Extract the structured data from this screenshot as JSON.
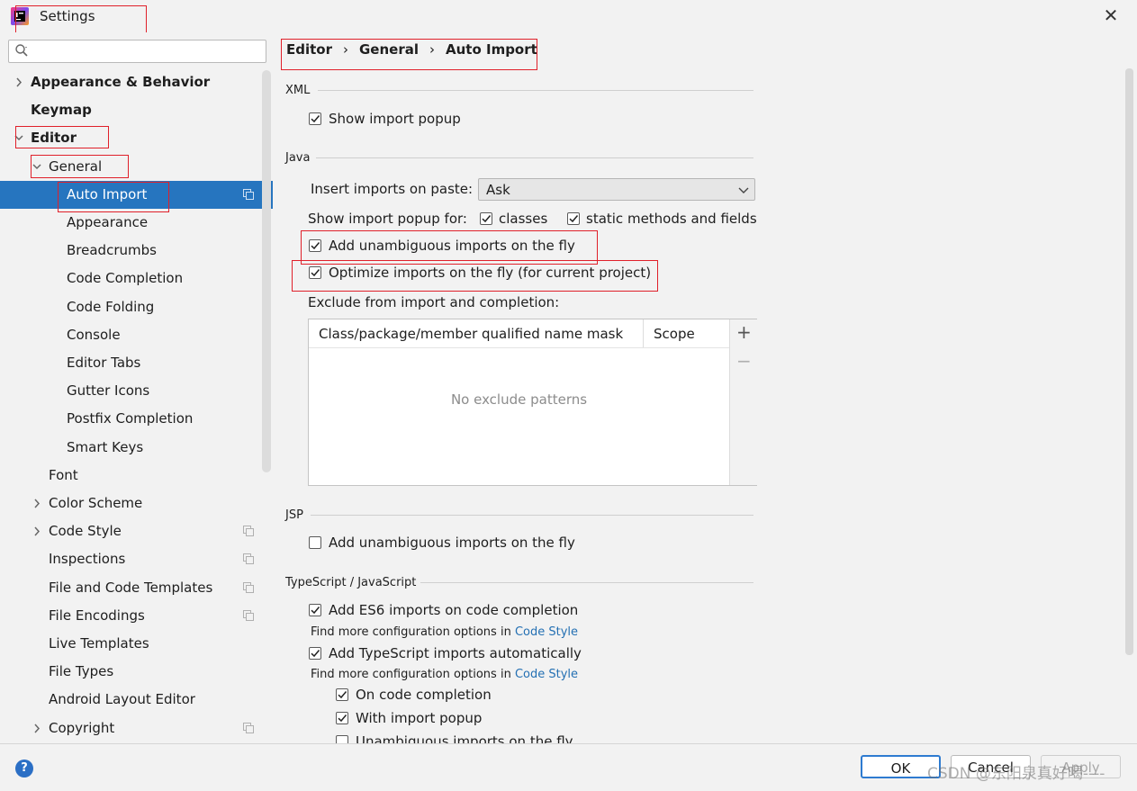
{
  "window": {
    "title": "Settings"
  },
  "search": {
    "placeholder": ""
  },
  "tree": [
    {
      "label": "Appearance & Behavior",
      "bold": true,
      "arrow": "right"
    },
    {
      "label": "Keymap",
      "bold": true,
      "arrow": ""
    },
    {
      "label": "Editor",
      "bold": true,
      "arrow": "down"
    },
    {
      "label": "General",
      "bold": false,
      "arrow": "down"
    },
    {
      "label": "Auto Import",
      "bold": false,
      "arrow": "",
      "selected": true,
      "badge": true
    },
    {
      "label": "Appearance"
    },
    {
      "label": "Breadcrumbs"
    },
    {
      "label": "Code Completion"
    },
    {
      "label": "Code Folding"
    },
    {
      "label": "Console"
    },
    {
      "label": "Editor Tabs"
    },
    {
      "label": "Gutter Icons"
    },
    {
      "label": "Postfix Completion"
    },
    {
      "label": "Smart Keys"
    },
    {
      "label": "Font"
    },
    {
      "label": "Color Scheme",
      "arrow": "right"
    },
    {
      "label": "Code Style",
      "arrow": "right",
      "badge": true
    },
    {
      "label": "Inspections",
      "badge": true
    },
    {
      "label": "File and Code Templates",
      "badge": true
    },
    {
      "label": "File Encodings",
      "badge": true
    },
    {
      "label": "Live Templates"
    },
    {
      "label": "File Types"
    },
    {
      "label": "Android Layout Editor"
    },
    {
      "label": "Copyright",
      "arrow": "right",
      "badge": true
    }
  ],
  "breadcrumb": {
    "items": [
      "Editor",
      "General",
      "Auto Import"
    ],
    "separator": "›"
  },
  "xml": {
    "section": "XML",
    "show_import_popup": {
      "label": "Show import popup",
      "checked": true
    }
  },
  "java": {
    "section": "Java",
    "insert_on_paste_label": "Insert imports on paste:",
    "insert_on_paste_value": "Ask",
    "show_popup_for_label": "Show import popup for:",
    "classes": {
      "label": "classes",
      "checked": true
    },
    "static_methods": {
      "label": "static methods and fields",
      "checked": true
    },
    "add_unambiguous": {
      "label": "Add unambiguous imports on the fly",
      "checked": true
    },
    "optimize_imports": {
      "label": "Optimize imports on the fly (for current project)",
      "checked": true
    },
    "exclude_label": "Exclude from import and completion:",
    "table": {
      "columns": [
        "Class/package/member qualified name mask",
        "Scope"
      ],
      "empty_text": "No exclude patterns",
      "add_symbol": "+",
      "remove_symbol": "−"
    }
  },
  "jsp": {
    "section": "JSP",
    "add_unambiguous": {
      "label": "Add unambiguous imports on the fly",
      "checked": false
    }
  },
  "typescript": {
    "section": "TypeScript / JavaScript",
    "es6": {
      "label": "Add ES6 imports on code completion",
      "checked": true
    },
    "hint_prefix": "Find more configuration options in ",
    "hint_link": "Code Style",
    "ts_auto": {
      "label": "Add TypeScript imports automatically",
      "checked": true
    },
    "on_completion": {
      "label": "On code completion",
      "checked": true
    },
    "with_popup": {
      "label": "With import popup",
      "checked": true
    },
    "unambiguous": {
      "label": "Unambiguous imports on the fly",
      "checked": false
    }
  },
  "buttons": {
    "ok": "OK",
    "cancel": "Cancel",
    "apply": "Apply",
    "help": "?"
  },
  "watermark": "CSDN @东阳泉真好喝----",
  "colors": {
    "accent": "#2675bf",
    "highlight_box": "#e0202a",
    "link": "#2470b3"
  }
}
